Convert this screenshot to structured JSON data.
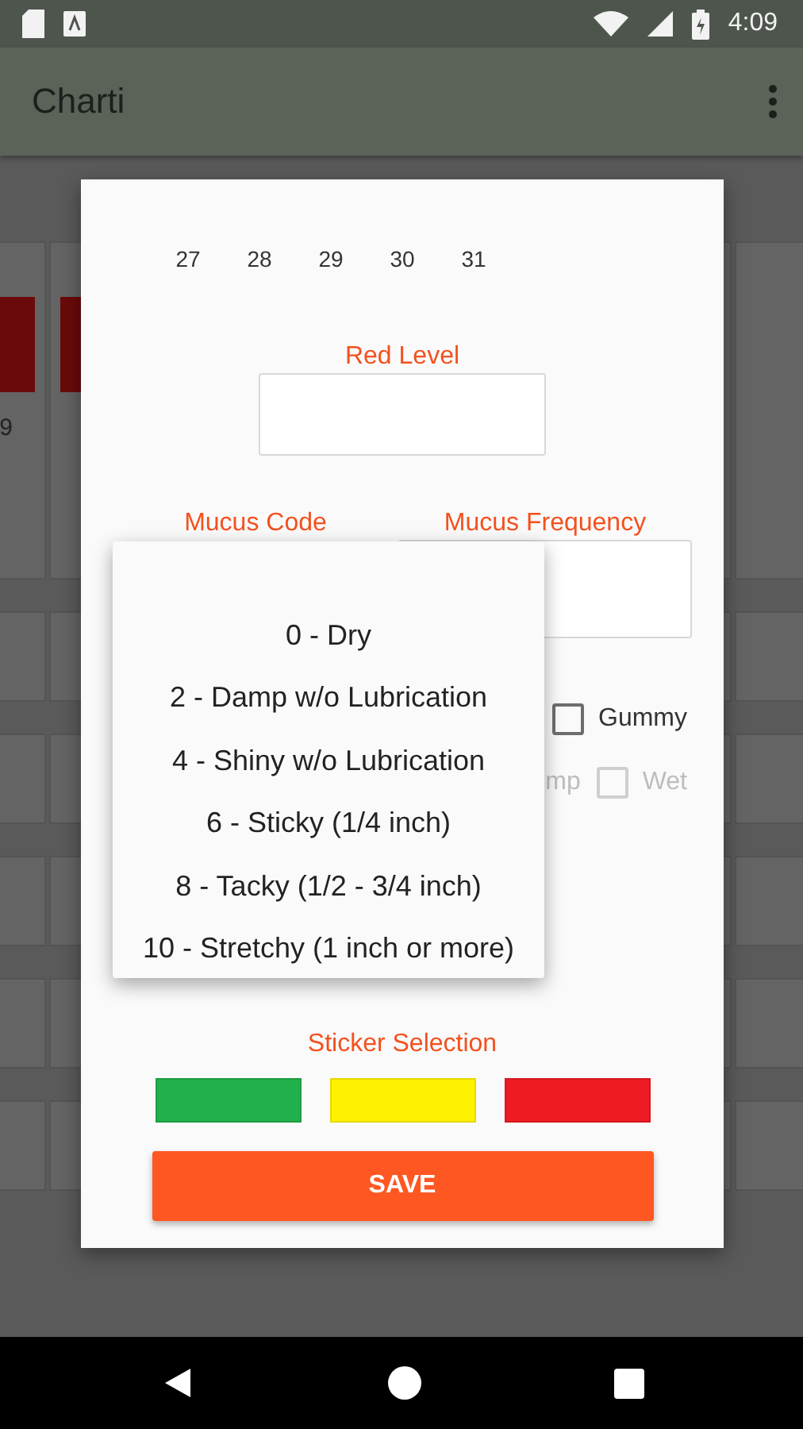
{
  "status_bar": {
    "time": "4:09"
  },
  "app_bar": {
    "title": "Charti"
  },
  "background_calendar": {
    "days": [
      {
        "label": "9",
        "marked": true
      },
      {
        "marked": true
      }
    ]
  },
  "dialog": {
    "calendar_rows": [
      [
        "27",
        "28",
        "29",
        "30",
        "31"
      ]
    ],
    "red_level": {
      "label": "Red Level"
    },
    "mucus_code": {
      "label": "Mucus Code",
      "expanded": true,
      "options": [
        "0 - Dry",
        "2 - Damp w/o Lubrication",
        "4 - Shiny w/o Lubrication",
        "6 - Sticky (1/4 inch)",
        "8 - Tacky (1/2 - 3/4 inch)",
        "10 - Stretchy (1 inch or more)"
      ]
    },
    "mucus_frequency": {
      "label": "Mucus Frequency"
    },
    "checkbox_rows": [
      {
        "items": [
          {
            "label": "Gummy",
            "checked": false,
            "disabled": false
          }
        ]
      },
      {
        "partial_label": "mp",
        "items": [
          {
            "label": "Wet",
            "checked": false,
            "disabled": true
          }
        ]
      }
    ],
    "sticker_selection": {
      "label": "Sticker Selection",
      "stickers": [
        {
          "color": "#21b04b"
        },
        {
          "color": "#fff200"
        },
        {
          "color": "#ed1c24"
        }
      ]
    },
    "save_button": "SAVE"
  }
}
